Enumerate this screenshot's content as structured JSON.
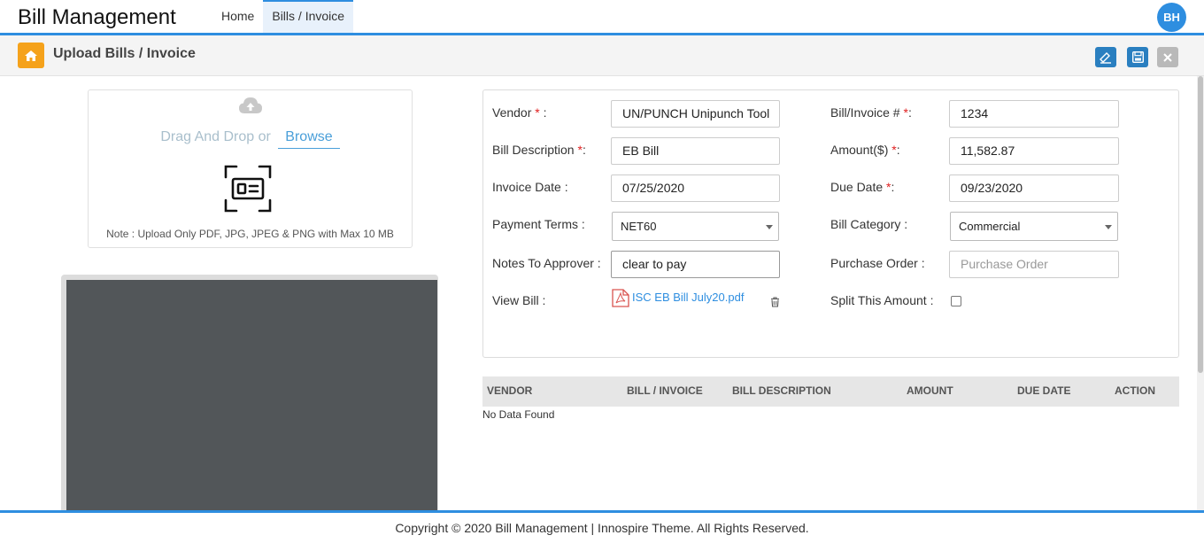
{
  "app": {
    "title": "Bill Management",
    "user_initials": "BH"
  },
  "nav": {
    "items": [
      {
        "label": "Home"
      },
      {
        "label": "Bills / Invoice"
      }
    ]
  },
  "subheader": {
    "title": "Upload Bills / Invoice",
    "icons": [
      "home-icon",
      "scan-icon",
      "save-icon",
      "close-icon"
    ]
  },
  "upload": {
    "drag_text": "Drag And Drop or",
    "browse_label": "Browse",
    "note": "Note : Upload Only PDF, JPG, JPEG & PNG with Max 10 MB"
  },
  "form": {
    "vendor": {
      "label": "Vendor",
      "suffix": " :",
      "value": "UN/PUNCH Unipunch Tool"
    },
    "bill_invoice_no": {
      "label": "Bill/Invoice #",
      "suffix": ":",
      "value": "1234"
    },
    "bill_description": {
      "label": "Bill Description",
      "suffix": ":",
      "value": "EB Bill"
    },
    "amount": {
      "label": "Amount($)",
      "suffix": ":",
      "value": "11,582.87"
    },
    "invoice_date": {
      "label": "Invoice Date :",
      "value": "07/25/2020"
    },
    "due_date": {
      "label": "Due Date",
      "suffix": ":",
      "value": "09/23/2020"
    },
    "payment_terms": {
      "label": "Payment Terms :",
      "value": "NET60"
    },
    "bill_category": {
      "label": "Bill Category :",
      "value": "Commercial"
    },
    "notes_to_approver": {
      "label": "Notes To Approver :",
      "value": "clear to pay"
    },
    "purchase_order": {
      "label": "Purchase Order :",
      "placeholder": "Purchase Order",
      "value": ""
    },
    "view_bill": {
      "label": "View Bill :",
      "file_name": "ISC EB Bill July20.pdf"
    },
    "split_amount": {
      "label": "Split This Amount :",
      "checked": false
    },
    "required_mark": "*"
  },
  "table": {
    "columns": [
      "VENDOR",
      "BILL / INVOICE",
      "BILL DESCRIPTION",
      "AMOUNT",
      "DUE DATE",
      "ACTION"
    ],
    "empty_text": "No Data Found"
  },
  "footer": {
    "text": "Copyright © 2020 Bill Management | Innospire Theme. All Rights Reserved."
  },
  "colors": {
    "accent": "#2e8ee0",
    "home_button": "#f5a21b",
    "required": "#e02020"
  }
}
